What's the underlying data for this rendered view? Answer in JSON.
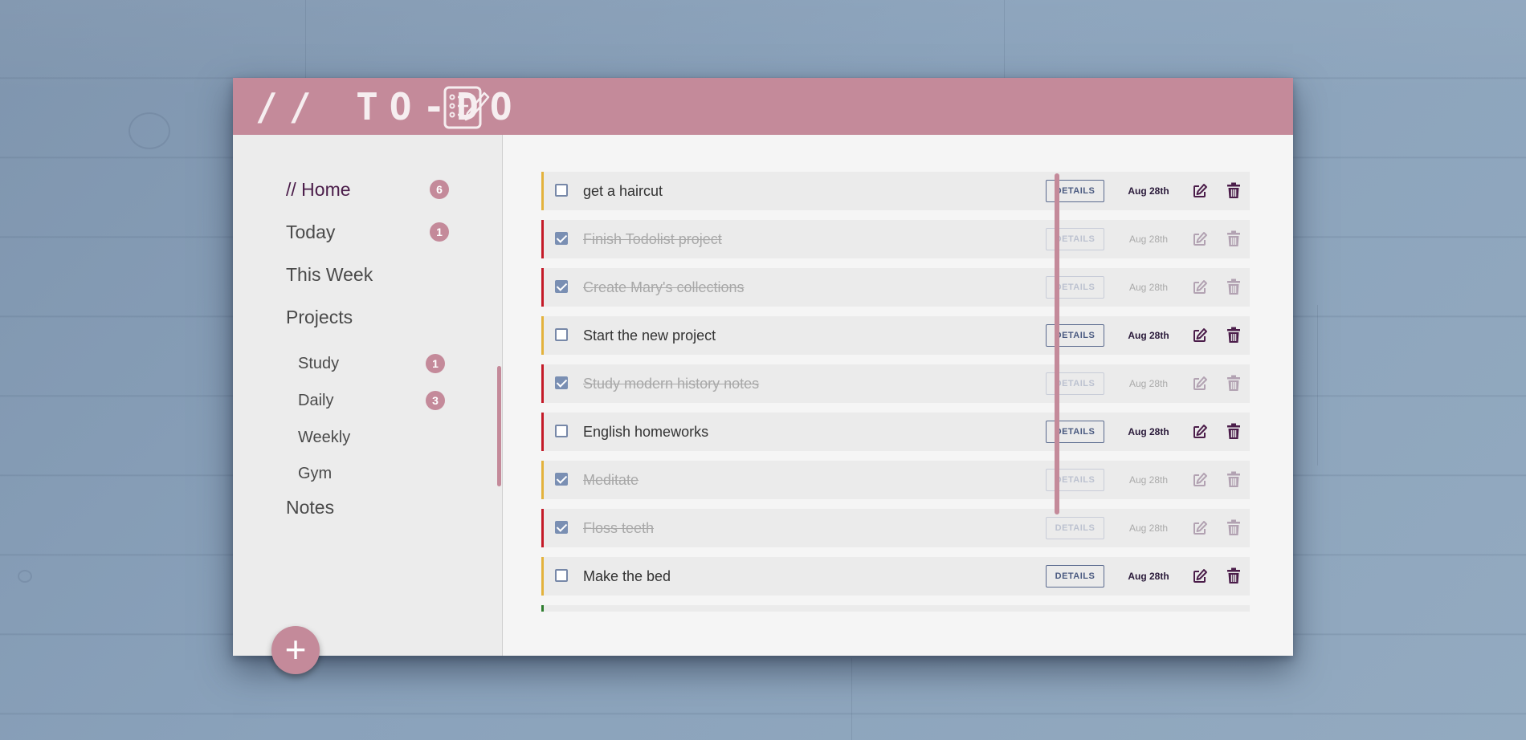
{
  "app": {
    "title": "// TO-DO",
    "icon": "notepad-icon"
  },
  "colors": {
    "header": "#c48a9a",
    "badge": "#c48a9a",
    "active_nav": "#4b1d4a",
    "priority_low": "#e3b23c",
    "priority_high": "#c41a28",
    "priority_done_green": "#2e7d2e",
    "checkbox_checked": "#7a8fb3"
  },
  "sidebar": {
    "items": [
      {
        "label": "// Home",
        "badge": "6",
        "active": true
      },
      {
        "label": "Today",
        "badge": "1"
      },
      {
        "label": "This Week"
      },
      {
        "label": "Projects"
      }
    ],
    "projects": [
      {
        "label": "Study",
        "badge": "1"
      },
      {
        "label": "Daily",
        "badge": "3"
      },
      {
        "label": "Weekly"
      },
      {
        "label": "Gym"
      }
    ],
    "notes_label": "Notes",
    "add_button": "+"
  },
  "tasks": [
    {
      "title": "get a haircut",
      "done": false,
      "priority": "low",
      "date": "Aug 28th",
      "details": "DETAILS"
    },
    {
      "title": "Finish Todolist project",
      "done": true,
      "priority": "high",
      "date": "Aug 28th",
      "details": "DETAILS"
    },
    {
      "title": "Create Mary's collections",
      "done": true,
      "priority": "high",
      "date": "Aug 28th",
      "details": "DETAILS"
    },
    {
      "title": "Start the new project",
      "done": false,
      "priority": "low",
      "date": "Aug 28th",
      "details": "DETAILS"
    },
    {
      "title": "Study modern history notes",
      "done": true,
      "priority": "high",
      "date": "Aug 28th",
      "details": "DETAILS"
    },
    {
      "title": "English homeworks",
      "done": false,
      "priority": "high",
      "date": "Aug 28th",
      "details": "DETAILS"
    },
    {
      "title": "Meditate",
      "done": true,
      "priority": "low",
      "date": "Aug 28th",
      "details": "DETAILS"
    },
    {
      "title": "Floss teeth",
      "done": true,
      "priority": "high",
      "date": "Aug 28th",
      "details": "DETAILS"
    },
    {
      "title": "Make the bed",
      "done": false,
      "priority": "low",
      "date": "Aug 28th",
      "details": "DETAILS"
    },
    {
      "title": "",
      "done": false,
      "priority": "green",
      "date": "",
      "details": ""
    }
  ]
}
